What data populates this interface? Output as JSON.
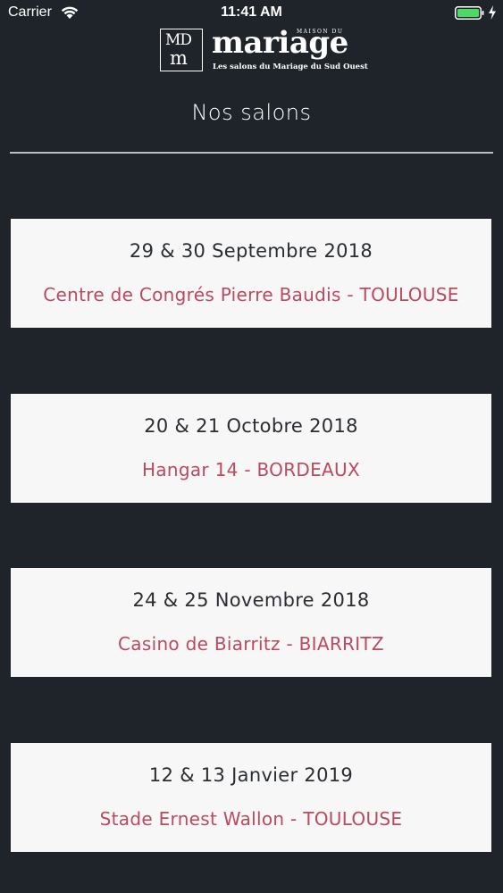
{
  "status_bar": {
    "carrier": "Carrier",
    "time": "11:41 AM",
    "wifi_icon": "wifi-icon",
    "battery_icon": "battery-icon",
    "battery_color": "#4cd964",
    "charging_icon": "charging-bolt-icon"
  },
  "logo": {
    "mark_line1": "MD",
    "mark_line2": "m",
    "small_text": "MAISON DU",
    "wordmark": "mariage",
    "tagline": "Les salons du Mariage du Sud Ouest"
  },
  "page": {
    "title": "Nos salons"
  },
  "colors": {
    "background": "#1e2429",
    "card": "#f7f7f7",
    "date_text": "#2a2e33",
    "venue_text": "#b94a5f"
  },
  "salons": [
    {
      "date": "29 & 30 Septembre 2018",
      "venue": "Centre de Congrés Pierre Baudis - TOULOUSE"
    },
    {
      "date": "20 & 21 Octobre 2018",
      "venue": "Hangar 14 - BORDEAUX"
    },
    {
      "date": "24 & 25 Novembre 2018",
      "venue": "Casino de Biarritz - BIARRITZ"
    },
    {
      "date": "12 & 13 Janvier 2019",
      "venue": "Stade Ernest Wallon - TOULOUSE"
    }
  ]
}
